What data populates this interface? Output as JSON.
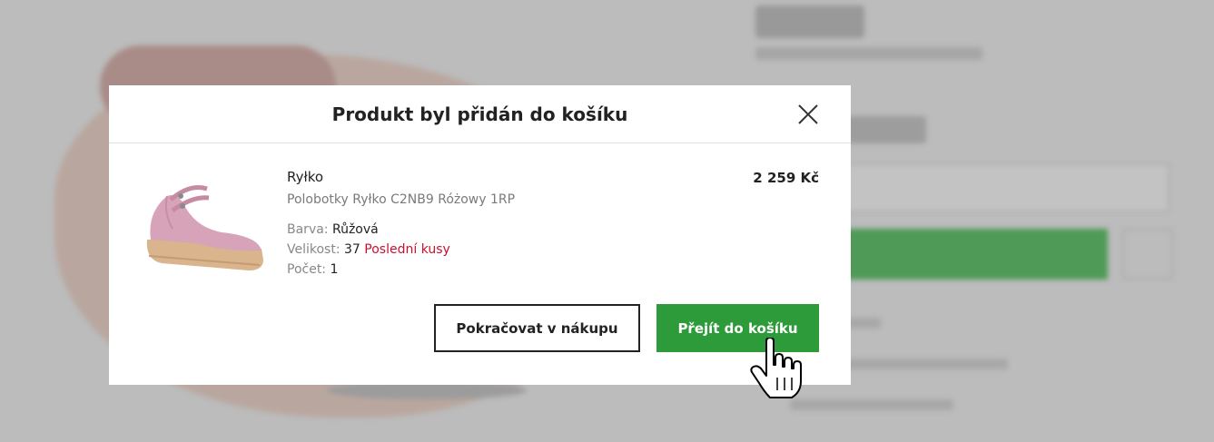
{
  "modal": {
    "title": "Produkt byl přidán do košíku",
    "close_icon": "close-icon",
    "product": {
      "brand": "Ryłko",
      "name": "Polobotky Ryłko C2NB9 Różowy 1RP",
      "price": "2 259 Kč",
      "color_label": "Barva:",
      "color_value": "Růžová",
      "size_label": "Velikost:",
      "size_value": "37",
      "stock_note": "Poslední kusy",
      "qty_label": "Počet:",
      "qty_value": "1"
    },
    "buttons": {
      "continue_label": "Pokračovat v nákupu",
      "cart_label": "Přejít do košíku"
    }
  },
  "colors": {
    "accent_green": "#2d9b3a",
    "warning_red": "#c8102e"
  }
}
